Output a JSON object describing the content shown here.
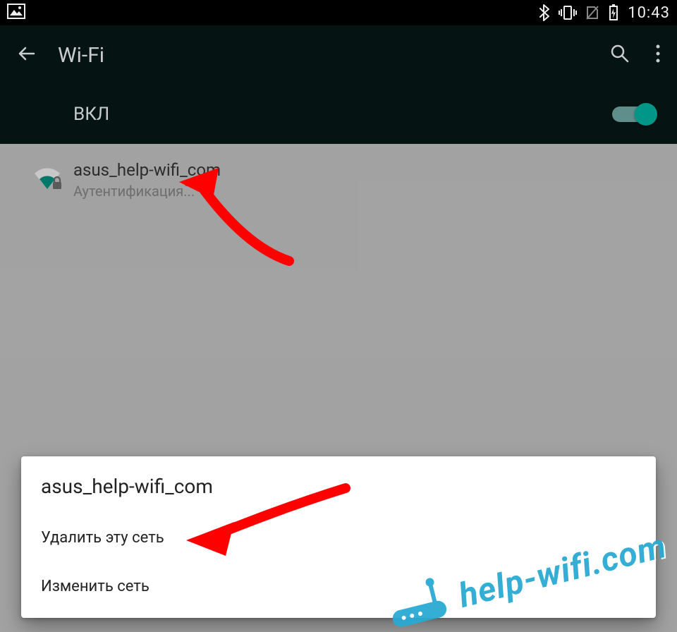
{
  "status_bar": {
    "clock": "10:43"
  },
  "toolbar": {
    "title": "Wi-Fi"
  },
  "wifi_toggle": {
    "label": "ВКЛ",
    "on": true
  },
  "network": {
    "ssid": "asus_help-wifi_com",
    "status": "Аутентификация..."
  },
  "popup": {
    "title": "asus_help-wifi_com",
    "delete_label": "Удалить эту сеть",
    "modify_label": "Изменить сеть"
  },
  "watermark": {
    "text": "help-wifi.com"
  }
}
